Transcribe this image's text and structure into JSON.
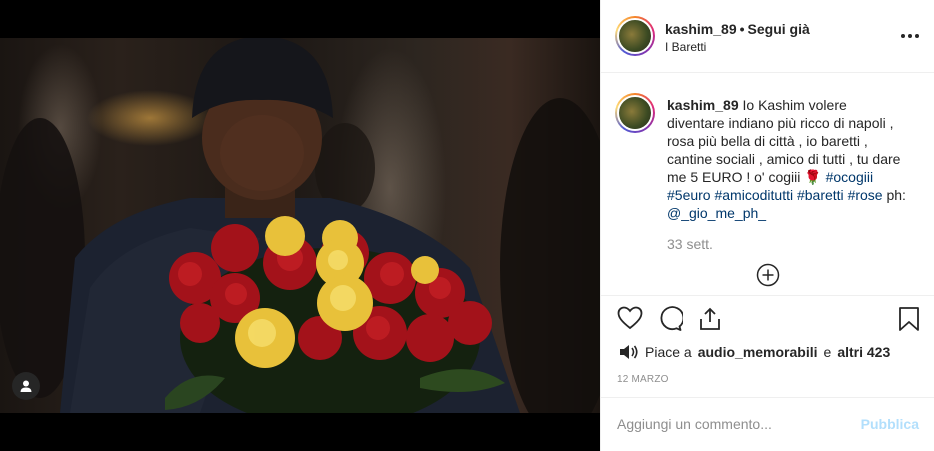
{
  "header": {
    "username": "kashim_89",
    "separator": "•",
    "follow_label": "Segui già",
    "location": "I Baretti",
    "more_icon": "more-horizontal-icon"
  },
  "caption": {
    "username": "kashim_89",
    "text": "Io Kashim volere diventare indiano più ricco di napoli , rosa più bella di città , io baretti , cantine sociali , amico di tutti , tu dare me 5 EURO ! o' cogiii ",
    "emoji": "🌹",
    "hashtags": [
      "#ocogiii",
      "#5euro",
      "#amicoditutti",
      "#baretti",
      "#rose"
    ],
    "credit_prefix": "ph:",
    "mention": "@_gio_me_ph_",
    "time": "33 sett."
  },
  "actions": {
    "like_icon": "heart-icon",
    "comment_icon": "comment-icon",
    "share_icon": "share-icon",
    "save_icon": "bookmark-icon"
  },
  "likes": {
    "prefix": "Piace a",
    "user": "audio_memorabili",
    "joiner": "e",
    "others": "altri 423"
  },
  "date": "12 MARZO",
  "comment_box": {
    "placeholder": "Aggiungi un commento...",
    "publish_label": "Pubblica"
  },
  "colors": {
    "accent_link": "#00376b",
    "publish_disabled": "#b2dffc",
    "muted": "#8e8e8e"
  }
}
